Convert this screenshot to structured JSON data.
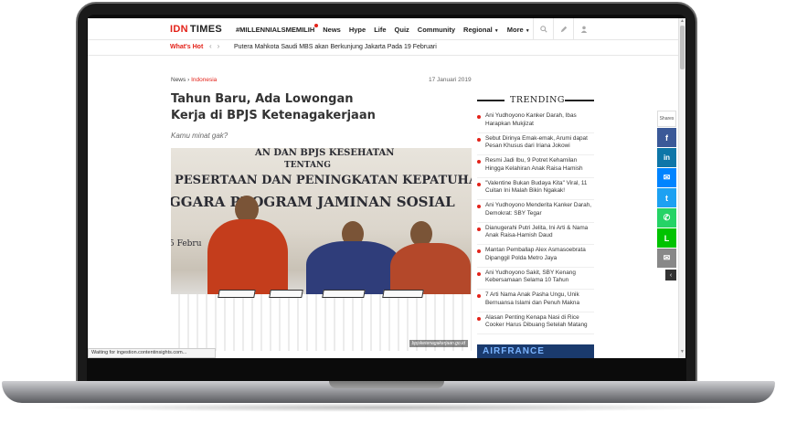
{
  "header": {
    "logo_idn": "IDN",
    "logo_times": "TIMES",
    "nav": [
      "#MILLENNIALSMEMILIH",
      "News",
      "Hype",
      "Life",
      "Quiz",
      "Community",
      "Regional",
      "More"
    ],
    "icons": [
      "search-icon",
      "pencil-icon",
      "user-icon"
    ]
  },
  "whats_hot": {
    "label": "What's Hot",
    "headline": "Putera Mahkota Saudi MBS akan Berkunjung Jakarta Pada 19 Februari"
  },
  "article": {
    "breadcrumb_home": "News",
    "breadcrumb_category": "Indonesia",
    "date": "17 Januari 2019",
    "title": "Tahun Baru, Ada Lowongan Kerja di BPJS Ketenagakerjaan",
    "subtitle": "Kamu minat gak?",
    "photo_banner": [
      "AN DAN BPJS KESEHATAN",
      "TENTANG",
      "PESERTAAN DAN PENINGKATAN KEPATUHAN",
      "GGARA PROGRAM JAMINAN SOSIAL",
      "5 Febru"
    ],
    "photo_caption": "bpjsketenagakerjaan.go.id"
  },
  "trending": {
    "title": "TRENDING",
    "items": [
      "Ani Yudhoyono Kanker Darah, Ibas Harapkan Mukjizat",
      "Sebut Dirinya Emak-emak, Arumi dapat Pesan Khusus dari Iriana Jokowi",
      "Resmi Jadi Ibu, 9 Potret Kehamilan Hingga Kelahiran Anak Raisa Hamish",
      "\"Valentine Bukan Budaya Kita\" Viral, 11 Cuitan Ini Malah Bikin Ngakak!",
      "Ani Yudhoyono Menderita Kanker Darah, Demokrat: SBY Tegar",
      "Dianugerahi Putri Jelita, Ini Arti & Nama Anak Raisa-Hamish Daud",
      "Mantan Pemballap Alex Asmasoebrata Dipanggil Polda Metro Jaya",
      "Ani Yudhoyono Sakit, SBY Kenang Kebersamaan Selama 10 Tahun",
      "7 Arti Nama Anak Pasha Ungu, Unik Bernuansa Islami dan Penuh Makna",
      "Alasan Penting Kenapa Nasi di Rice Cooker Harus Dibuang Setelah Matang"
    ],
    "ad_text": "AIRFRANCE"
  },
  "share": {
    "label": "Shares",
    "buttons": [
      {
        "icon": "facebook-icon",
        "glyph": "f",
        "color": "#3b5998"
      },
      {
        "icon": "linkedin-icon",
        "glyph": "in",
        "color": "#0e76a8"
      },
      {
        "icon": "messenger-icon",
        "glyph": "✉",
        "color": "#0084ff"
      },
      {
        "icon": "twitter-icon",
        "glyph": "t",
        "color": "#1da1f2"
      },
      {
        "icon": "whatsapp-icon",
        "glyph": "✆",
        "color": "#25d366"
      },
      {
        "icon": "line-icon",
        "glyph": "L",
        "color": "#00c300"
      },
      {
        "icon": "email-icon",
        "glyph": "✉",
        "color": "#888888"
      }
    ],
    "toggle": "‹"
  },
  "status_bar": "Waiting for ingestion.contentinsights.com..."
}
